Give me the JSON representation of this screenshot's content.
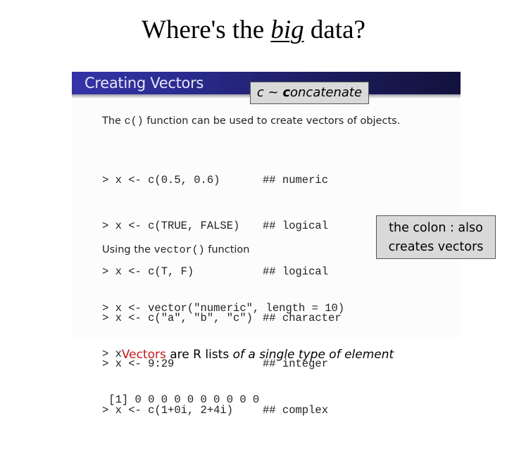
{
  "page": {
    "title_pre": "Where's the ",
    "title_emph": "big",
    "title_post": " data?"
  },
  "slide": {
    "header": "Creating Vectors",
    "intro_pre": "The ",
    "intro_code": "c()",
    "intro_post": " function can be used to create vectors of objects.",
    "code_lines": [
      {
        "code": "> x <- c(0.5, 0.6)",
        "comment": "## numeric"
      },
      {
        "code": "> x <- c(TRUE, FALSE)",
        "comment": "## logical"
      },
      {
        "code": "> x <- c(T, F)",
        "comment": "## logical"
      },
      {
        "code": "> x <- c(\"a\", \"b\", \"c\")",
        "comment": "## character"
      },
      {
        "code": "> x <- 9:29",
        "comment": "## integer"
      },
      {
        "code": "> x <- c(1+0i, 2+4i)",
        "comment": "## complex"
      }
    ],
    "section2_pre": "Using the ",
    "section2_code": "vector()",
    "section2_post": " function",
    "code2_lines": [
      "> x <- vector(\"numeric\", length = 10)",
      "> x",
      " [1] 0 0 0 0 0 0 0 0 0 0"
    ]
  },
  "callouts": {
    "concat_c": "c",
    "concat_sep": " ~ ",
    "concat_bold": "c",
    "concat_rest": "oncatenate",
    "colon_line1": "the colon : also",
    "colon_line2": "creates vectors"
  },
  "footer": {
    "red": "Vectors",
    "mid": " are R lists ",
    "italic": "of a single type of element"
  },
  "colors": {
    "accent_red": "#c0181c",
    "slide_header": "#2a2a8e",
    "callout_bg": "#d9d9d9"
  }
}
